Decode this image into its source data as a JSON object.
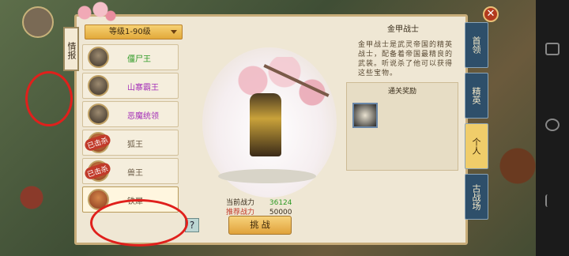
{
  "panel": {
    "bookmark_label": "情报",
    "level_filter": "等级1-90级"
  },
  "boss_list": [
    {
      "name": "僵尸王",
      "color": "green",
      "defeated_badge": ""
    },
    {
      "name": "山寨霸王",
      "color": "purple",
      "defeated_badge": ""
    },
    {
      "name": "恶魔统领",
      "color": "purple",
      "defeated_badge": ""
    },
    {
      "name": "狐王",
      "color": "gray",
      "defeated_badge": "已击杀"
    },
    {
      "name": "兽王",
      "color": "gray",
      "defeated_badge": "已击杀"
    },
    {
      "name": "铁犀",
      "color": "gray",
      "defeated_badge": ""
    }
  ],
  "stats": {
    "current_power_label": "当前战力",
    "current_power_value": "36124",
    "recommended_power_label": "推荐战力",
    "recommended_power_value": "50000"
  },
  "buttons": {
    "help": "?",
    "challenge": "挑 战",
    "close": "✕"
  },
  "info": {
    "title": "金甲战士",
    "description": "金甲战士是武灵帝国的精英战士，配备着帝国最精良的武装。听说杀了他可以获得这些宝物。",
    "reward_title": "通关奖励"
  },
  "side_tabs": [
    {
      "label": "首领",
      "active": false
    },
    {
      "label": "精英",
      "active": false
    },
    {
      "label": "个人",
      "active": true
    },
    {
      "label": "古战场",
      "active": false
    }
  ],
  "colors": {
    "green": "#2f9b26",
    "purple": "#a42fb8",
    "accent_gold": "#e2a93a",
    "tab_blue": "#2e4f6a",
    "annotation_red": "#e0201c"
  }
}
